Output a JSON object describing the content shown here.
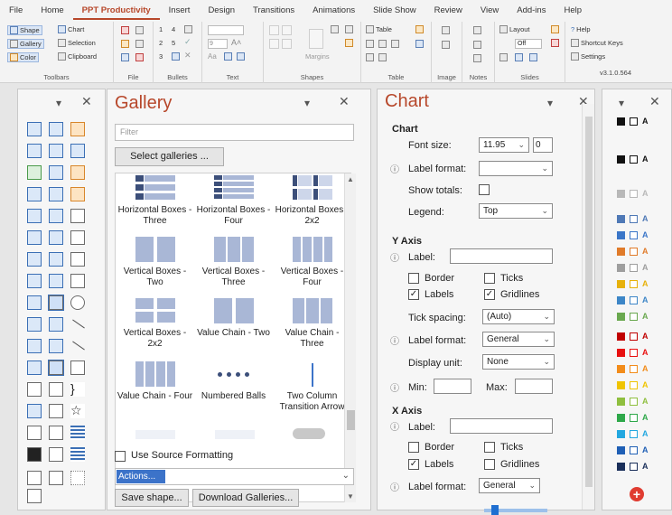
{
  "ribbon": {
    "tabs": [
      "File",
      "Home",
      "PPT Productivity",
      "Insert",
      "Design",
      "Transitions",
      "Animations",
      "Slide Show",
      "Review",
      "View",
      "Add-ins",
      "Help"
    ],
    "active_tab": "PPT Productivity",
    "toolbars": {
      "shape": "Shape",
      "chart": "Chart",
      "gallery": "Gallery",
      "selection": "Selection",
      "color": "Color",
      "clipboard": "Clipboard",
      "label": "Toolbars"
    },
    "file": {
      "label": "File"
    },
    "bullets": {
      "n1": "1",
      "n4": "4",
      "n2": "2",
      "n5": "5",
      "n3": "3",
      "label": "Bullets"
    },
    "text": {
      "font_size": "9",
      "label": "Text"
    },
    "shapes": {
      "margins": "Margins",
      "label": "Shapes"
    },
    "table": {
      "table": "Table",
      "label": "Table"
    },
    "image": {
      "label": "Image"
    },
    "notes": {
      "label": "Notes"
    },
    "slides": {
      "layout": "Layout",
      "off": "Off",
      "label": "Slides"
    },
    "help": {
      "help": "Help",
      "shortcut": "Shortcut Keys",
      "settings": "Settings",
      "version": "v3.1.0.564"
    }
  },
  "gallery": {
    "title": "Gallery",
    "filter_placeholder": "Filter",
    "select_button": "Select galleries ...",
    "items": [
      "Horizontal Boxes - Three",
      "Horizontal Boxes - Four",
      "Horizontal Boxes - 2x2",
      "Vertical Boxes - Two",
      "Vertical Boxes - Three",
      "Vertical Boxes - Four",
      "Vertical Boxes - 2x2",
      "Value Chain - Two",
      "Value Chain - Three",
      "Value Chain - Four",
      "Numbered Balls",
      "Two Column Transition Arrow"
    ],
    "use_source": "Use Source Formatting",
    "actions": "Actions...",
    "save_button": "Save shape...",
    "download_button": "Download Galleries..."
  },
  "chart": {
    "title": "Chart",
    "section_chart": "Chart",
    "font_size_label": "Font size:",
    "font_size_value": "11.95",
    "font_size_step": "0",
    "label_format_label": "Label format:",
    "show_totals_label": "Show totals:",
    "legend_label": "Legend:",
    "legend_value": "Top",
    "y_axis": {
      "title": "Y Axis",
      "label_label": "Label:",
      "border": "Border",
      "ticks": "Ticks",
      "labels": "Labels",
      "gridlines": "Gridlines",
      "tick_spacing_label": "Tick spacing:",
      "tick_spacing_value": "(Auto)",
      "label_format_label": "Label format:",
      "label_format_value": "General",
      "display_unit_label": "Display unit:",
      "display_unit_value": "None",
      "min_label": "Min:",
      "max_label": "Max:"
    },
    "x_axis": {
      "title": "X Axis",
      "label_label": "Label:",
      "border": "Border",
      "ticks": "Ticks",
      "labels": "Labels",
      "gridlines": "Gridlines",
      "label_format_label": "Label format:",
      "label_format_value": "General"
    }
  },
  "colors": {
    "letter": "A",
    "swatches": [
      "#111111",
      "#111111",
      "#b8b8b8",
      "#4f79b6",
      "#3a76c8",
      "#e07b2a",
      "#9e9e9e",
      "#e7b10a",
      "#3d86c7",
      "#6aa84f",
      "#c00000",
      "#e81010",
      "#f28c1a",
      "#f0c400",
      "#8fbf3f",
      "#2ea84a",
      "#22a7e0",
      "#1f5fb5",
      "#1a2f5a",
      "#7f3fa6",
      "#3b6fb5"
    ]
  }
}
